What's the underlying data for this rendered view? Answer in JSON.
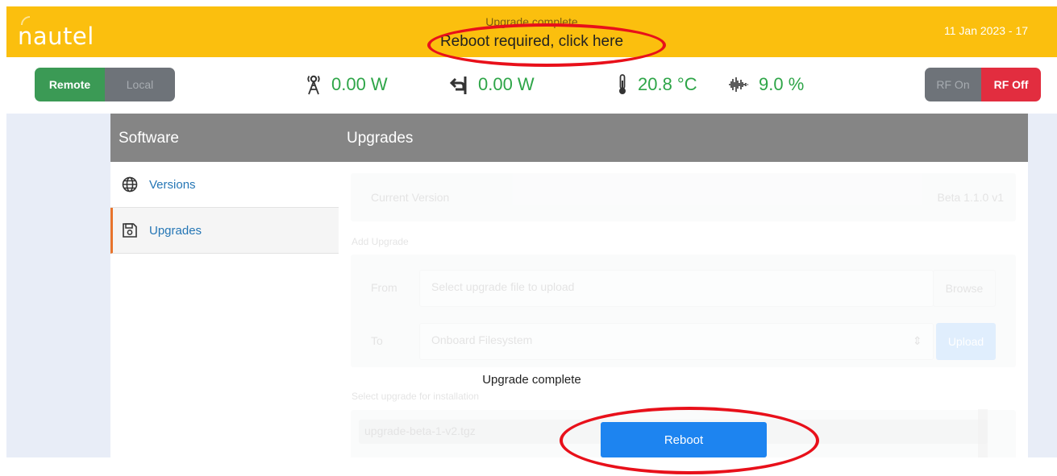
{
  "header": {
    "logo": "nautel",
    "status_line_1": "Upgrade complete",
    "status_line_2": "Reboot required, click here",
    "date": "11 Jan 2023 - 17"
  },
  "controls": {
    "remote_label": "Remote",
    "local_label": "Local",
    "rf_on_label": "RF On",
    "rf_off_label": "RF Off"
  },
  "meters": {
    "forward_power": "0.00 W",
    "reflected_power": "0.00 W",
    "temperature": "20.8 °C",
    "modulation": "9.0 %"
  },
  "sidebar": {
    "title": "Software",
    "items": [
      {
        "label": "Versions",
        "icon": "globe-icon",
        "active": false
      },
      {
        "label": "Upgrades",
        "icon": "floppy-disk-icon",
        "active": true
      }
    ]
  },
  "main": {
    "title": "Upgrades",
    "current_version_label": "Current Version",
    "current_version_value": "Beta 1.1.0 v1",
    "add_upgrade_label": "Add Upgrade",
    "from_label": "From",
    "from_placeholder": "Select upgrade file to upload",
    "browse_label": "Browse",
    "to_label": "To",
    "to_value": "Onboard Filesystem",
    "upload_label": "Upload",
    "select_upgrade_label": "Select upgrade for installation",
    "upgrade_file": "upgrade-beta-1-v2.tgz"
  },
  "dialog": {
    "message": "Upgrade complete",
    "reboot_label": "Reboot"
  },
  "colors": {
    "header_bg": "#fbbf0e",
    "remote_active": "#3b9a55",
    "rf_off_active": "#e22d3f",
    "meter_text": "#2ea548",
    "panel_header": "#858585",
    "link": "#2576b5",
    "primary_button": "#1d84f0",
    "annotation": "#e8101a"
  }
}
